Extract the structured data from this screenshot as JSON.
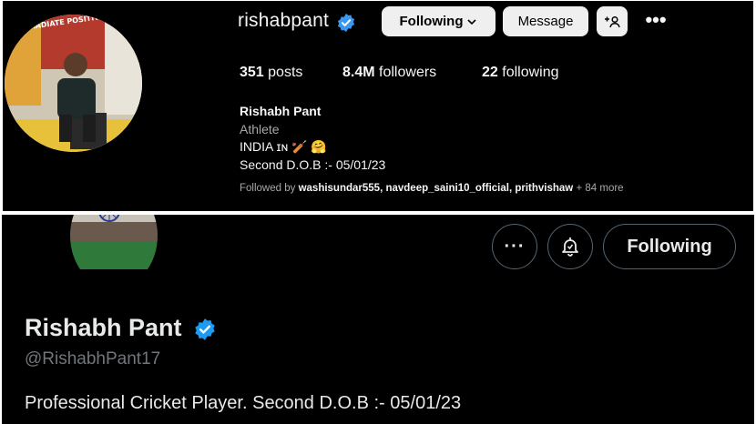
{
  "instagram": {
    "username": "rishabpant",
    "buttons": {
      "following_label": "Following",
      "message_label": "Message",
      "adduser_label": "+8"
    },
    "more_icon": "more-horizontal-icon",
    "stats": {
      "posts_count": "351",
      "posts_label": "posts",
      "followers_count": "8.4M",
      "followers_label": "followers",
      "following_count": "22",
      "following_label": "following"
    },
    "bio": {
      "name": "Rishabh Pant",
      "category": "Athlete",
      "line1": "INDIA ɪɴ 🏏 🤗",
      "line2": "Second D.O.B :- 05/01/23"
    },
    "followed_by": {
      "prefix": "Followed by",
      "accounts": "washisundar555, navdeep_saini10_official, prithvishaw",
      "suffix": "+ 84 more"
    },
    "avatar_text": "RADIATE POSITIVITY",
    "accent_verified": "#3897f0"
  },
  "twitter": {
    "name": "Rishabh Pant",
    "handle": "@RishabhPant17",
    "bio": "Professional Cricket Player. Second D.O.B :- 05/01/23",
    "following_label": "Following",
    "more_icon": "more-horizontal-icon",
    "bell_icon": "notification-bell-icon",
    "accent_verified": "#1d9bf0"
  }
}
